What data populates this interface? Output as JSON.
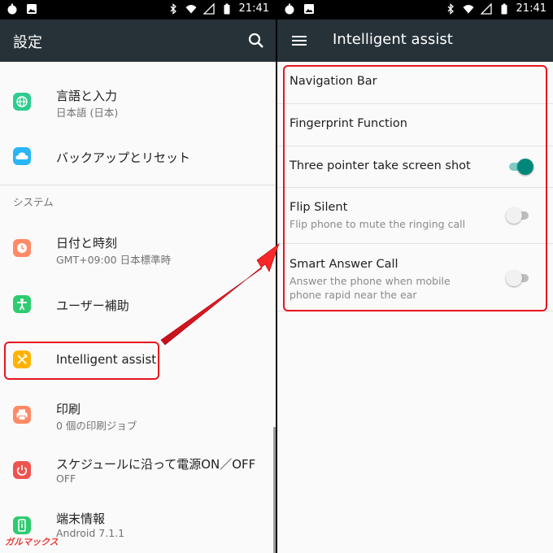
{
  "status_bar": {
    "time": "21:41"
  },
  "left_screen": {
    "title": "設定",
    "items_top": [
      {
        "id": "language",
        "title": "言語と入力",
        "subtitle": "日本語 (日本)",
        "icon": "globe-icon",
        "color": "#2ecc8f"
      },
      {
        "id": "backup",
        "title": "バックアップとリセット",
        "icon": "cloud-icon",
        "color": "#29b6f6"
      }
    ],
    "section_system": "システム",
    "items_system": [
      {
        "id": "datetime",
        "title": "日付と時刻",
        "subtitle": "GMT+09:00 日本標準時",
        "icon": "clock-icon",
        "color": "#ff8a65"
      },
      {
        "id": "accessibility",
        "title": "ユーザー補助",
        "icon": "accessibility-icon",
        "color": "#2ecc71"
      },
      {
        "id": "intelligent",
        "title": "Intelligent assist",
        "icon": "tools-icon",
        "color": "#ffb300"
      },
      {
        "id": "print",
        "title": "印刷",
        "subtitle": "0 個の印刷ジョブ",
        "icon": "printer-icon",
        "color": "#ff8a65"
      },
      {
        "id": "schedule",
        "title": "スケジュールに沿って電源ON／OFF",
        "subtitle": "OFF",
        "icon": "power-icon",
        "color": "#ef5350"
      },
      {
        "id": "about",
        "title": "端末情報",
        "subtitle": "Android 7.1.1",
        "icon": "phone-info-icon",
        "color": "#2ecc71"
      }
    ]
  },
  "right_screen": {
    "title": "Intelligent assist",
    "items": [
      {
        "id": "nav",
        "title": "Navigation Bar"
      },
      {
        "id": "fingerprint",
        "title": "Fingerprint Function"
      },
      {
        "id": "three_pointer",
        "title": "Three pointer take screen shot",
        "toggle": true
      },
      {
        "id": "flip",
        "title": "Flip Silent",
        "subtitle": "Flip phone to mute the ringing call",
        "toggle": false
      },
      {
        "id": "smart_answer",
        "title": "Smart Answer Call",
        "subtitle": "Answer the phone when mobile phone rapid near the ear",
        "toggle": false
      }
    ]
  },
  "watermark": "ガルマックス",
  "colors": {
    "appbar": "#263238",
    "accent": "#00897b",
    "highlight": "#e8141e"
  }
}
